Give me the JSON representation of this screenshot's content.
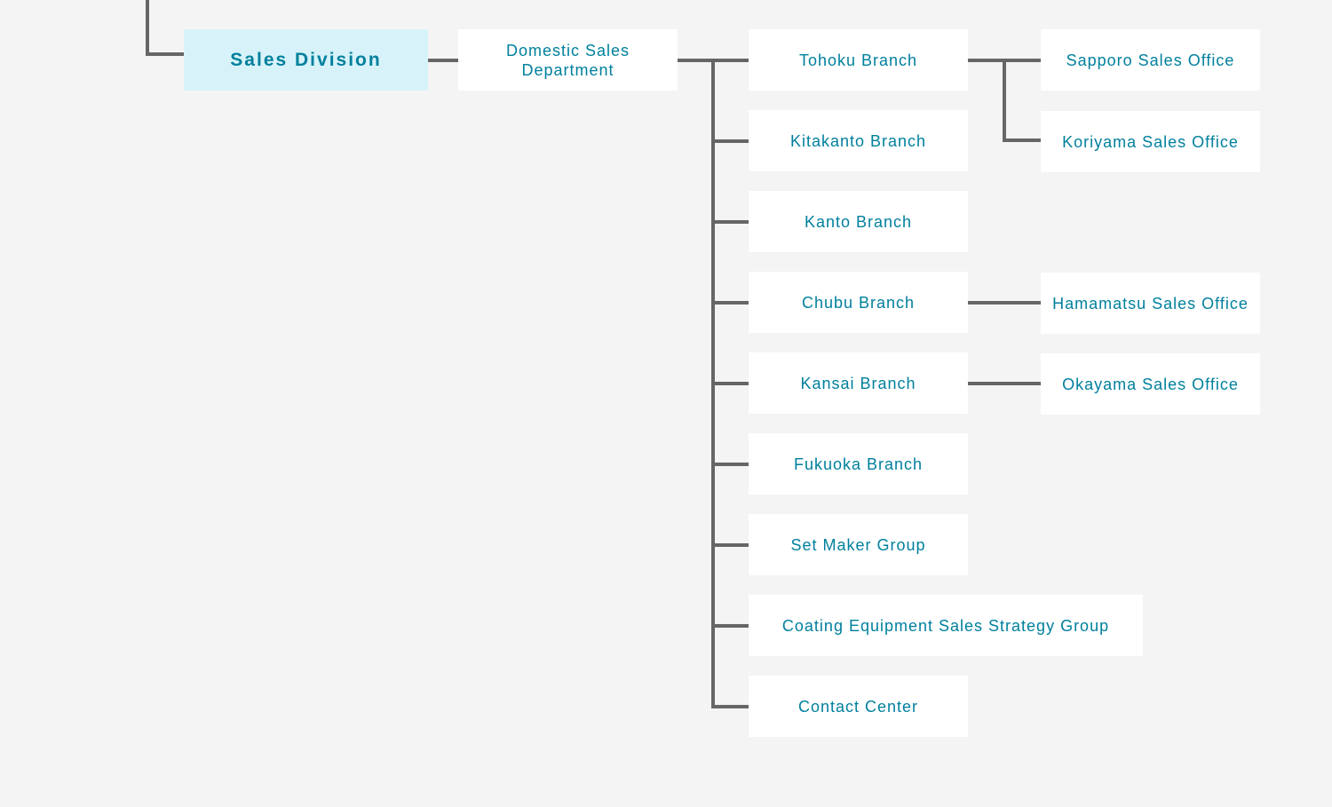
{
  "org_chart": {
    "division": "Sales Division",
    "department": [
      "Domestic Sales",
      "Department"
    ],
    "branches": [
      {
        "name": "Tohoku Branch",
        "offices": [
          "Sapporo Sales Office",
          "Koriyama Sales Office"
        ]
      },
      {
        "name": "Kitakanto Branch",
        "offices": []
      },
      {
        "name": "Kanto Branch",
        "offices": []
      },
      {
        "name": "Chubu Branch",
        "offices": [
          "Hamamatsu Sales Office"
        ]
      },
      {
        "name": "Kansai Branch",
        "offices": [
          "Okayama Sales Office"
        ]
      },
      {
        "name": "Fukuoka Branch",
        "offices": []
      },
      {
        "name": "Set Maker Group",
        "offices": []
      },
      {
        "name": "Coating Equipment Sales Strategy Group",
        "offices": []
      },
      {
        "name": "Contact Center",
        "offices": []
      }
    ]
  },
  "colors": {
    "text": "#00809d",
    "root_bg": "#d7f3f9",
    "node_bg": "#ffffff",
    "line": "#666666",
    "page_bg": "#f4f4f4"
  }
}
